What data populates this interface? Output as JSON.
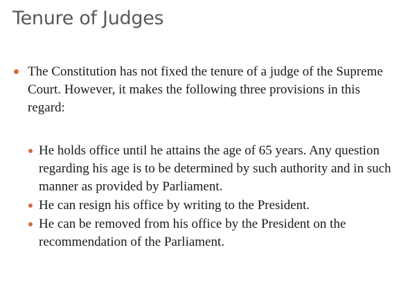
{
  "slide": {
    "title": "Tenure of Judges",
    "bullets": [
      {
        "text": "The Constitution has not fixed the tenure of a judge of the Supreme Court. However, it makes the following three provisions in this regard:"
      }
    ],
    "sub_bullets": [
      {
        "text": "He holds office until he attains the age of 65 years. Any question regarding his age is to be determined by such authority and in such manner as provided by Parliament."
      },
      {
        "text": "He can resign his office by writing to the President."
      },
      {
        "text": "He can be removed from his office by the President on the recommendation of the Parliament."
      }
    ],
    "colors": {
      "title": "#595959",
      "bullet_marker": "#d46a3a",
      "body_text": "#1a1a1a",
      "background": "#ffffff"
    }
  }
}
